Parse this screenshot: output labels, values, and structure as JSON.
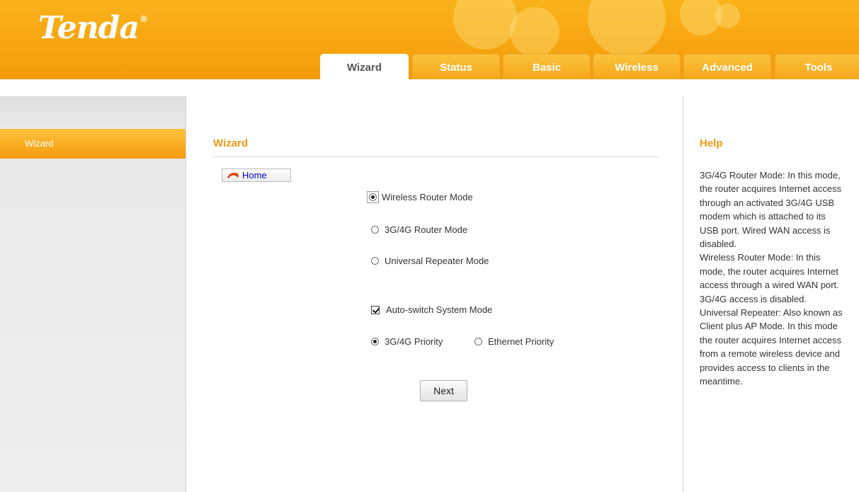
{
  "brand": {
    "logo": "Tenda",
    "registered": "®"
  },
  "tabs": [
    {
      "label": "Wizard",
      "active": true
    },
    {
      "label": "Status",
      "active": false
    },
    {
      "label": "Basic",
      "active": false
    },
    {
      "label": "Wireless",
      "active": false
    },
    {
      "label": "Advanced",
      "active": false
    },
    {
      "label": "Tools",
      "active": false
    }
  ],
  "sidebar": {
    "items": [
      {
        "label": "Wizard",
        "active": true
      }
    ]
  },
  "main": {
    "title": "Wizard",
    "home_label": "Home",
    "modes": [
      {
        "label": "Wireless Router Mode",
        "checked": true
      },
      {
        "label": "3G/4G Router Mode",
        "checked": false
      },
      {
        "label": "Universal Repeater Mode",
        "checked": false
      }
    ],
    "auto_switch": {
      "label": "Auto-switch System Mode",
      "checked": true
    },
    "priority": [
      {
        "label": "3G/4G Priority",
        "checked": true
      },
      {
        "label": "Ethernet Priority",
        "checked": false
      }
    ],
    "next_label": "Next"
  },
  "help": {
    "title": "Help",
    "paragraphs": [
      "3G/4G Router Mode: In this mode, the router acquires Internet access through an activated 3G/4G USB modem which is attached to its USB port. Wired WAN access is disabled.",
      "Wireless Router Mode: In this mode, the router acquires Internet access through a wired WAN port. 3G/4G access is disabled.",
      "Universal Repeater: Also known as Client plus AP Mode. In this mode the router acquires Internet access from a remote wireless device and provides access to clients in the meantime."
    ]
  },
  "colors": {
    "accent": "#f19a12",
    "header": "#f7a812",
    "link": "#0000cc"
  }
}
